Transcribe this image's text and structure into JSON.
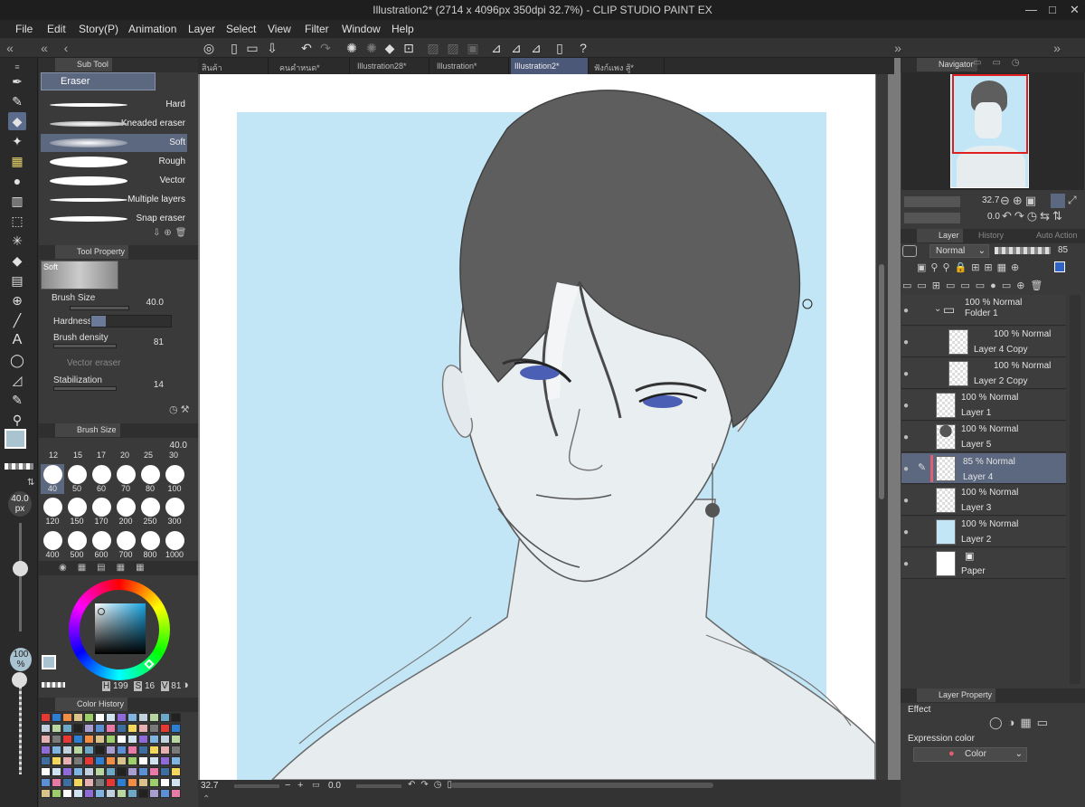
{
  "titlebar": {
    "title": "Illustration2* (2714 x 4096px 350dpi 32.7%)  - CLIP STUDIO PAINT EX",
    "minimize": "—",
    "maximize": "□",
    "close": "✕"
  },
  "menu": [
    "File",
    "Edit",
    "Story(P)",
    "Animation",
    "Layer",
    "Select",
    "View",
    "Filter",
    "Window",
    "Help"
  ],
  "sub_tool": {
    "tab_label": "Sub Tool",
    "group": "Eraser",
    "brushes": [
      "Hard",
      "Kneaded eraser",
      "Soft",
      "Rough",
      "Vector",
      "Multiple layers",
      "Snap eraser"
    ],
    "selected": "Soft"
  },
  "tool_property": {
    "tab_label": "Tool Property",
    "preview_label": "Soft",
    "brush_size_label": "Brush Size",
    "brush_size_value": "40.0",
    "hardness_label": "Hardness",
    "brush_density_label": "Brush density",
    "brush_density_value": "81",
    "vector_eraser_label": "Vector eraser",
    "stabilization_label": "Stabilization",
    "stabilization_value": "14"
  },
  "brush_size_panel": {
    "tab_label": "Brush Size",
    "value": "40.0",
    "ruler": [
      "12",
      "15",
      "17",
      "20",
      "25",
      "30"
    ],
    "sizes": [
      "40",
      "50",
      "60",
      "70",
      "80",
      "100",
      "120",
      "150",
      "170",
      "200",
      "250",
      "300",
      "400",
      "500",
      "600",
      "700",
      "800",
      "1000"
    ],
    "selected": "40"
  },
  "left_strip": {
    "size_value": "40.0",
    "size_unit": "px",
    "opacity_value": "100",
    "opacity_unit": "%"
  },
  "color_wheel": {
    "h": "199",
    "s": "16",
    "v": "81",
    "h_label": "H",
    "s_label": "S",
    "v_label": "V",
    "main_color": "#a9c3d0",
    "sub_color": "#f2a7c4"
  },
  "color_history": {
    "tab_label": "Color History"
  },
  "doc_tabs": [
    "สินค้าคาแรคเตอร์*",
    "คนคำหนด*",
    "Illustration28*",
    "Illustration*",
    "Illustration2*",
    "ฟังก์แพง สู้*"
  ],
  "active_doc_tab": "Illustration2*",
  "canvas_status": {
    "zoom": "32.7",
    "rotation": "0.0"
  },
  "navigator": {
    "tab_label": "Navigator",
    "zoom": "32.7",
    "rotation": "0.0"
  },
  "layer_panel": {
    "tab_label": "Layer",
    "history_tab": "History",
    "auto_action_tab": "Auto Action",
    "blend_mode": "Normal",
    "opacity": "85",
    "layers": [
      {
        "mode": "100 % Normal",
        "name": "Folder 1"
      },
      {
        "mode": "100 % Normal",
        "name": "Layer 4 Copy"
      },
      {
        "mode": "100 % Normal",
        "name": "Layer 2 Copy"
      },
      {
        "mode": "100 % Normal",
        "name": "Layer 1"
      },
      {
        "mode": "100 % Normal",
        "name": "Layer 5"
      },
      {
        "mode": "85 % Normal",
        "name": "Layer 4"
      },
      {
        "mode": "100 % Normal",
        "name": "Layer 3"
      },
      {
        "mode": "100 % Normal",
        "name": "Layer 2"
      },
      {
        "mode": "",
        "name": "Paper"
      }
    ]
  },
  "layer_property": {
    "tab_label": "Layer Property",
    "effect_label": "Effect",
    "expression_color_label": "Expression color",
    "expression_color_value": "Color"
  },
  "colors": {
    "accent": "#5c6880",
    "canvas_bg": "#c3e6f6",
    "hair": "#5e5e5e"
  }
}
